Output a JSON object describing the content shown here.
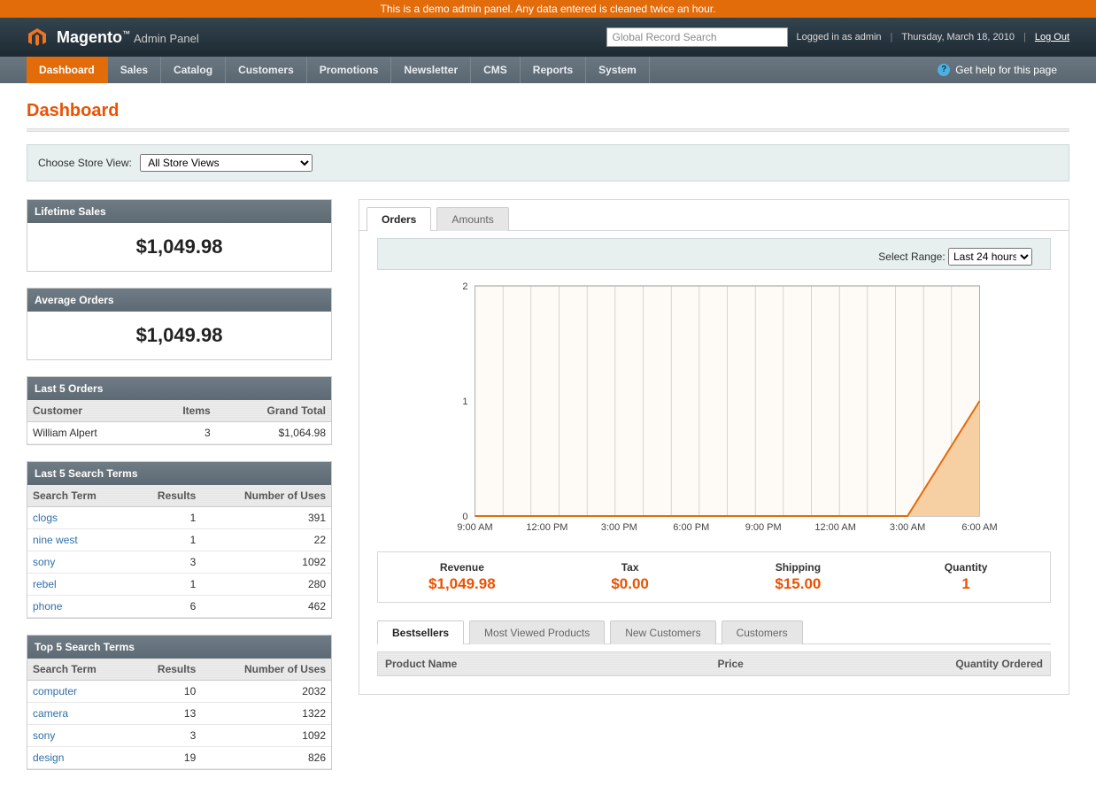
{
  "demo_banner": "This is a demo admin panel. Any data entered is cleaned twice an hour.",
  "logo": {
    "brand": "Magento",
    "suffix": "Admin Panel"
  },
  "header": {
    "search_placeholder": "Global Record Search",
    "logged_in": "Logged in as admin",
    "date": "Thursday, March 18, 2010",
    "logout": "Log Out"
  },
  "nav": {
    "items": [
      "Dashboard",
      "Sales",
      "Catalog",
      "Customers",
      "Promotions",
      "Newsletter",
      "CMS",
      "Reports",
      "System"
    ],
    "help": "Get help for this page"
  },
  "page_title": "Dashboard",
  "store_switcher": {
    "label": "Choose Store View:",
    "selected": "All Store Views"
  },
  "widgets": {
    "lifetime": {
      "title": "Lifetime Sales",
      "value": "$1,049.98"
    },
    "average": {
      "title": "Average Orders",
      "value": "$1,049.98"
    },
    "last_orders": {
      "title": "Last 5 Orders",
      "columns": [
        "Customer",
        "Items",
        "Grand Total"
      ],
      "rows": [
        {
          "customer": "William Alpert",
          "items": "3",
          "total": "$1,064.98"
        }
      ]
    },
    "last_search": {
      "title": "Last 5 Search Terms",
      "columns": [
        "Search Term",
        "Results",
        "Number of Uses"
      ],
      "rows": [
        {
          "term": "clogs",
          "results": "1",
          "uses": "391"
        },
        {
          "term": "nine west",
          "results": "1",
          "uses": "22"
        },
        {
          "term": "sony",
          "results": "3",
          "uses": "1092"
        },
        {
          "term": "rebel",
          "results": "1",
          "uses": "280"
        },
        {
          "term": "phone",
          "results": "6",
          "uses": "462"
        }
      ]
    },
    "top_search": {
      "title": "Top 5 Search Terms",
      "columns": [
        "Search Term",
        "Results",
        "Number of Uses"
      ],
      "rows": [
        {
          "term": "computer",
          "results": "10",
          "uses": "2032"
        },
        {
          "term": "camera",
          "results": "13",
          "uses": "1322"
        },
        {
          "term": "sony",
          "results": "3",
          "uses": "1092"
        },
        {
          "term": "design",
          "results": "19",
          "uses": "826"
        }
      ]
    }
  },
  "main_tabs": {
    "items": [
      "Orders",
      "Amounts"
    ],
    "range_label": "Select Range:",
    "range_selected": "Last 24 hours"
  },
  "chart_data": {
    "type": "area",
    "title": "",
    "xlabel": "",
    "ylabel": "",
    "ylim": [
      0,
      2
    ],
    "categories": [
      "9:00 AM",
      "12:00 PM",
      "3:00 PM",
      "6:00 PM",
      "9:00 PM",
      "12:00 AM",
      "3:00 AM",
      "6:00 AM"
    ],
    "values": [
      0,
      0,
      0,
      0,
      0,
      0,
      0,
      1
    ]
  },
  "totals": [
    {
      "label": "Revenue",
      "value": "$1,049.98"
    },
    {
      "label": "Tax",
      "value": "$0.00"
    },
    {
      "label": "Shipping",
      "value": "$15.00"
    },
    {
      "label": "Quantity",
      "value": "1"
    }
  ],
  "subtabs": {
    "items": [
      "Bestsellers",
      "Most Viewed Products",
      "New Customers",
      "Customers"
    ],
    "columns": [
      "Product Name",
      "Price",
      "Quantity Ordered"
    ]
  }
}
